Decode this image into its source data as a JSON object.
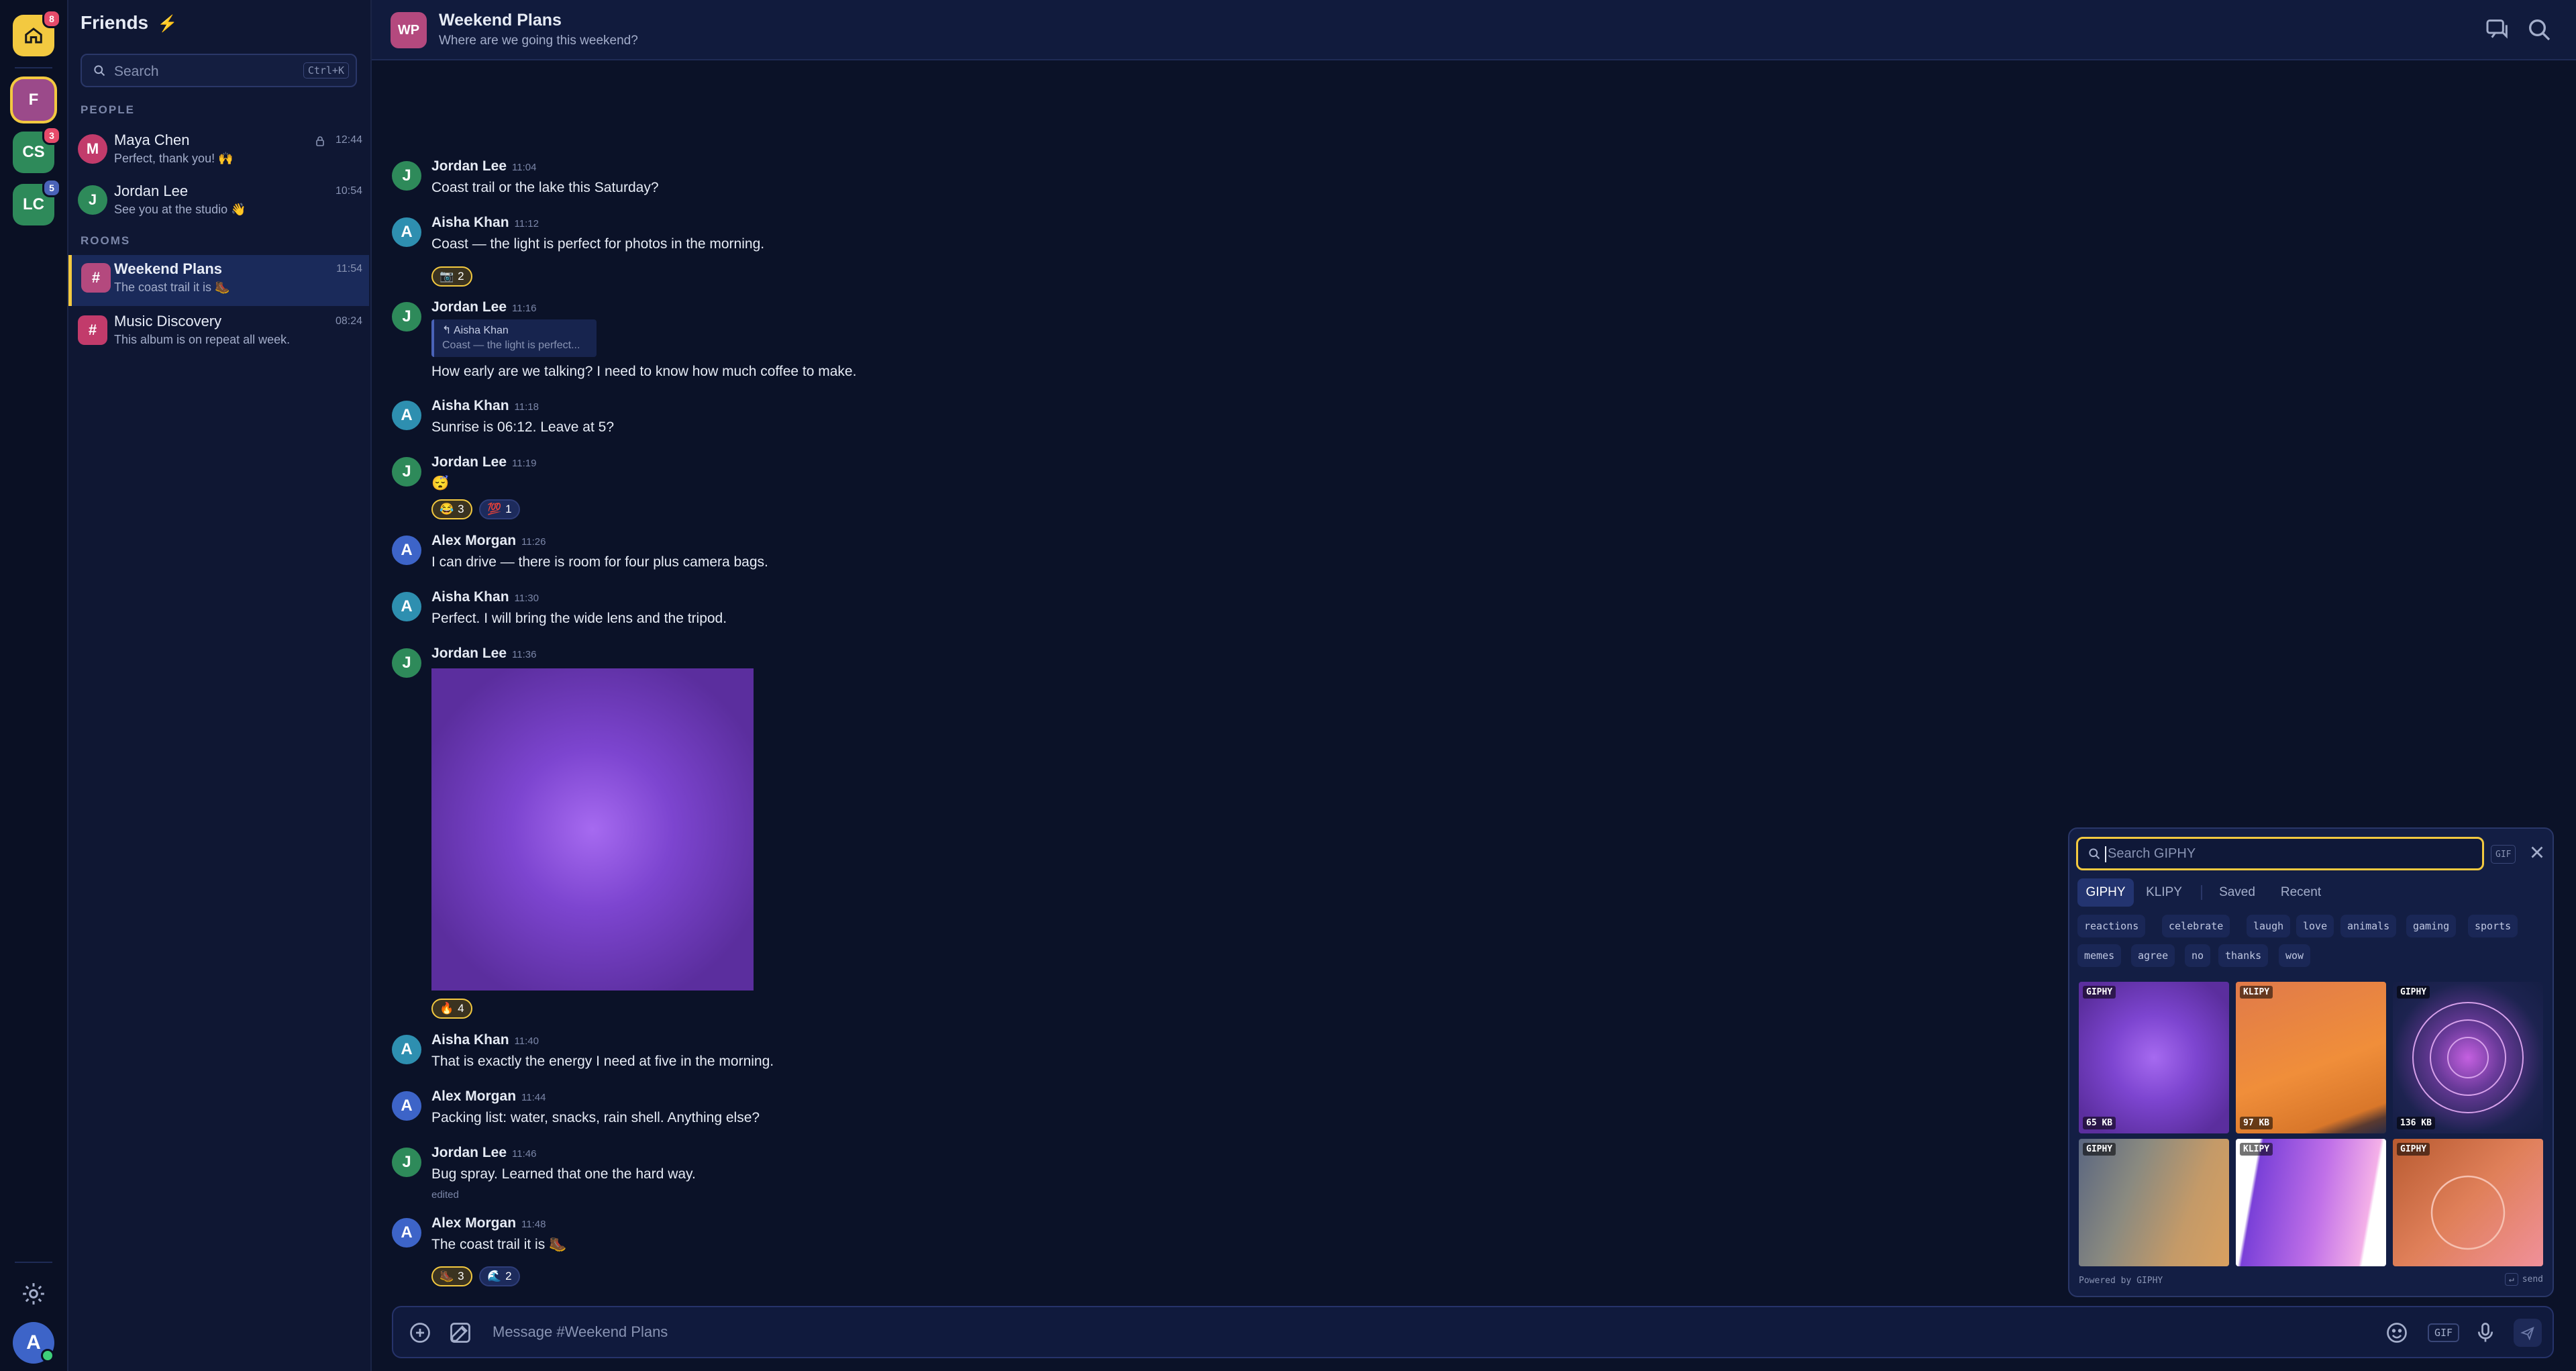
{
  "rail": {
    "home_badge": "8",
    "servers": [
      {
        "initials": "F",
        "badge": "",
        "color": "#9b4a8a"
      },
      {
        "initials": "CS",
        "badge": "3",
        "color": "#2e8a5a"
      },
      {
        "initials": "LC",
        "badge": "5",
        "color": "#2e8a5a"
      }
    ],
    "user_initial": "A"
  },
  "sidebar": {
    "title": "Friends",
    "search_placeholder": "Search",
    "search_shortcut": "Ctrl+K",
    "people_label": "PEOPLE",
    "rooms_label": "ROOMS",
    "people": [
      {
        "initial": "M",
        "name": "Maya Chen",
        "preview": "Perfect, thank you! 🙌",
        "time": "12:44",
        "color": "#c23b6b"
      },
      {
        "initial": "J",
        "name": "Jordan Lee",
        "preview": "See you at the studio 👋",
        "time": "10:54",
        "color": "#2e8a5a"
      }
    ],
    "rooms": [
      {
        "initial": "#",
        "name": "Weekend Plans",
        "preview": "The coast trail it is 🥾",
        "time": "11:54",
        "color": "#b4497e"
      },
      {
        "initial": "#",
        "name": "Music Discovery",
        "preview": "This album is on repeat all week.",
        "time": "08:24",
        "color": "#c23b6b"
      }
    ]
  },
  "header": {
    "initials": "WP",
    "title": "Weekend Plans",
    "subtitle": "Where are we going this weekend?"
  },
  "messages": [
    {
      "author": "Jordan Lee",
      "initial": "J",
      "time": "11:04",
      "text": "Coast trail or the lake this Saturday?",
      "color": "#2e8a5a"
    },
    {
      "author": "Aisha Khan",
      "initial": "A",
      "time": "11:12",
      "text": "Coast — the light is perfect for photos in the morning.",
      "color": "#2e8fb0"
    },
    {
      "author": "Jordan Lee",
      "initial": "J",
      "time": "11:16",
      "text": "How early are we talking? I need to know how much coffee to make.",
      "color": "#2e8a5a",
      "reply_author": "↰ Aisha Khan",
      "reply_text": "Coast — the light is perfect..."
    },
    {
      "author": "Aisha Khan",
      "initial": "A",
      "time": "11:18",
      "text": "Sunrise is 06:12. Leave at 5?",
      "color": "#2e8fb0"
    },
    {
      "author": "Jordan Lee",
      "initial": "J",
      "time": "11:19",
      "text": "😴",
      "color": "#2e8a5a"
    },
    {
      "author": "Alex Morgan",
      "initial": "A",
      "time": "11:26",
      "text": "I can drive — there is room for four plus camera bags.",
      "color": "#3d64c8"
    },
    {
      "author": "Aisha Khan",
      "initial": "A",
      "time": "11:30",
      "text": "Perfect. I will bring the wide lens and the tripod.",
      "color": "#2e8fb0"
    },
    {
      "author": "Jordan Lee",
      "initial": "J",
      "time": "11:36",
      "text": "",
      "color": "#2e8a5a"
    },
    {
      "author": "Aisha Khan",
      "initial": "A",
      "time": "11:40",
      "text": "That is exactly the energy I need at five in the morning.",
      "color": "#2e8fb0"
    },
    {
      "author": "Alex Morgan",
      "initial": "A",
      "time": "11:44",
      "text": "Packing list: water, snacks, rain shell. Anything else?",
      "color": "#3d64c8"
    },
    {
      "author": "Jordan Lee",
      "initial": "J",
      "time": "11:46",
      "text": "Bug spray. Learned that one the hard way.",
      "color": "#2e8a5a",
      "edited": "edited"
    },
    {
      "author": "Alex Morgan",
      "initial": "A",
      "time": "11:48",
      "text": "The coast trail it is 🥾",
      "color": "#3d64c8"
    }
  ],
  "reactions": {
    "m2": [
      {
        "emoji": "📷",
        "count": "2"
      }
    ],
    "m5": [
      {
        "emoji": "😂",
        "count": "3"
      },
      {
        "emoji": "💯",
        "count": "1"
      }
    ],
    "m8": [
      {
        "emoji": "🔥",
        "count": "4"
      }
    ],
    "m12": [
      {
        "emoji": "🥾",
        "count": "3"
      },
      {
        "emoji": "🌊",
        "count": "2"
      }
    ]
  },
  "composer": {
    "placeholder": "Message #Weekend Plans",
    "gif_label": "GIF"
  },
  "gif_picker": {
    "search_placeholder": "Search GIPHY",
    "badge": "GIF",
    "tabs": [
      "GIPHY",
      "KLIPY",
      "Saved",
      "Recent"
    ],
    "chips_row1": [
      "reactions",
      "celebrate",
      "laugh",
      "love",
      "animals",
      "gaming",
      "sports"
    ],
    "chips_row2": [
      "memes",
      "agree",
      "no",
      "thanks",
      "wow"
    ],
    "tiles": [
      {
        "source": "GIPHY",
        "size": "65 KB"
      },
      {
        "source": "KLIPY",
        "size": "97 KB"
      },
      {
        "source": "GIPHY",
        "size": "136 KB"
      },
      {
        "source": "GIPHY",
        "size": ""
      },
      {
        "source": "KLIPY",
        "size": ""
      },
      {
        "source": "GIPHY",
        "size": ""
      }
    ],
    "footer_left": "Powered by GIPHY",
    "footer_key": "↵",
    "footer_right": "send"
  },
  "colors": {
    "accent": "#f3c940",
    "background": "#0b1228"
  }
}
